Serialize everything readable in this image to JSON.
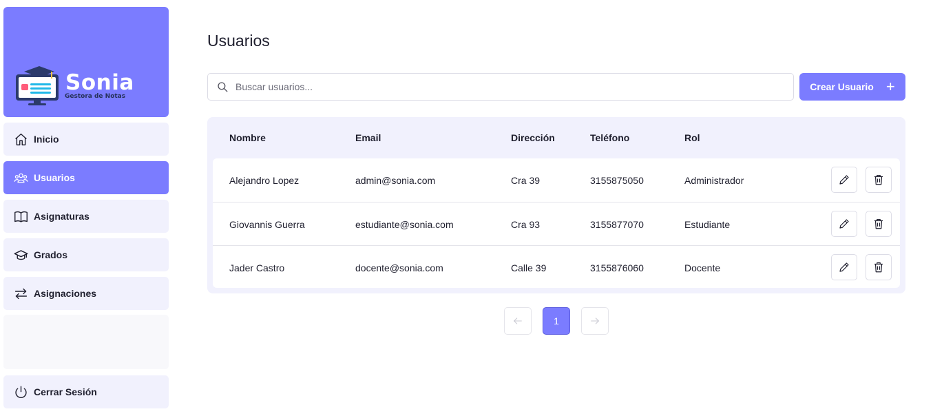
{
  "brand": {
    "name": "Sonia",
    "subtitle": "Gestora de Notas"
  },
  "sidebar": {
    "items": [
      {
        "label": "Inicio",
        "icon": "home-icon",
        "active": false
      },
      {
        "label": "Usuarios",
        "icon": "users-icon",
        "active": true
      },
      {
        "label": "Asignaturas",
        "icon": "book-icon",
        "active": false
      },
      {
        "label": "Grados",
        "icon": "graduation-cap-icon",
        "active": false
      },
      {
        "label": "Asignaciones",
        "icon": "arrows-swap-icon",
        "active": false
      }
    ],
    "logout": {
      "label": "Cerrar Sesión",
      "icon": "power-icon"
    }
  },
  "page": {
    "title": "Usuarios"
  },
  "search": {
    "placeholder": "Buscar usuarios...",
    "value": ""
  },
  "create_button": {
    "label": "Crear Usuario",
    "icon": "plus-icon"
  },
  "table": {
    "headers": [
      "Nombre",
      "Email",
      "Dirección",
      "Teléfono",
      "Rol"
    ],
    "rows": [
      {
        "nombre": "Alejandro Lopez",
        "email": "admin@sonia.com",
        "direccion": "Cra 39",
        "telefono": "3155875050",
        "rol": "Administrador"
      },
      {
        "nombre": "Giovannis Guerra",
        "email": "estudiante@sonia.com",
        "direccion": "Cra 93",
        "telefono": "3155877070",
        "rol": "Estudiante"
      },
      {
        "nombre": "Jader Castro",
        "email": "docente@sonia.com",
        "direccion": "Calle 39",
        "telefono": "3155876060",
        "rol": "Docente"
      }
    ]
  },
  "pagination": {
    "current": "1"
  },
  "colors": {
    "accent": "#7b7cff",
    "panel": "#f1f1fd",
    "text": "#1f1f2e"
  }
}
